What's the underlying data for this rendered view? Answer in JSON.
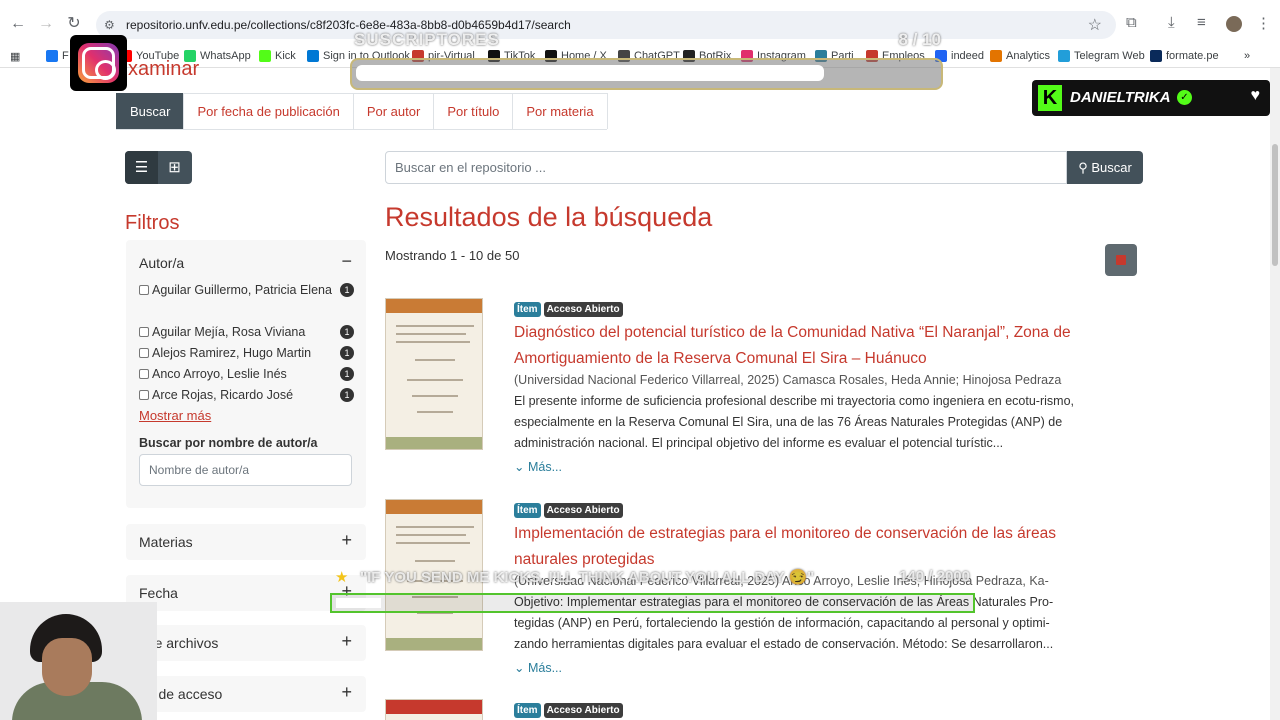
{
  "browser": {
    "url": "repositorio.unfv.edu.pe/collections/c8f203fc-6e8e-483a-8bb8-d0b4659b4d17/search",
    "bookmarks": [
      {
        "label": "F",
        "color": "#1877f2"
      },
      {
        "label": "YouTube",
        "color": "#ff0000"
      },
      {
        "label": "WhatsApp",
        "color": "#25d366"
      },
      {
        "label": "Kick",
        "color": "#53fc18"
      },
      {
        "label": "Sign in to Outlook",
        "color": "#0078d4"
      },
      {
        "label": "pir-Virtual",
        "color": "#c6392d"
      },
      {
        "label": "TikTok",
        "color": "#111111"
      },
      {
        "label": "Home / X",
        "color": "#111111"
      },
      {
        "label": "ChatGPT",
        "color": "#444444"
      },
      {
        "label": "BotRix",
        "color": "#222222"
      },
      {
        "label": "Instagram",
        "color": "#e1306c"
      },
      {
        "label": "Parti",
        "color": "#2b7e9b"
      },
      {
        "label": "Empleos",
        "color": "#c6392d"
      },
      {
        "label": "indeed",
        "color": "#2164f3"
      },
      {
        "label": "Analytics",
        "color": "#e37400"
      },
      {
        "label": "Telegram Web",
        "color": "#229ed9"
      },
      {
        "label": "formate.pe",
        "color": "#0a2a5a"
      }
    ]
  },
  "page": {
    "heading_fragment": "xaminar",
    "tabs": [
      "Buscar",
      "Por fecha de publicación",
      "Por autor",
      "Por título",
      "Por materia"
    ],
    "search": {
      "placeholder": "Buscar en el repositorio ...",
      "button": "Buscar"
    },
    "filters": {
      "title": "Filtros",
      "author_box": {
        "title": "Autor/a",
        "toggle": "−",
        "facets": [
          {
            "label": "Aguilar Guillermo, Patricia Elena",
            "count": "1"
          },
          {
            "label": "Aguilar Mejía, Rosa Viviana",
            "count": "1"
          },
          {
            "label": "Alejos Ramirez, Hugo Martin",
            "count": "1"
          },
          {
            "label": "Anco Arroyo, Leslie Inés",
            "count": "1"
          },
          {
            "label": "Arce Rojas, Ricardo José",
            "count": "1"
          }
        ],
        "show_more": "Mostrar más",
        "search_label": "Buscar por nombre de autor/a",
        "search_placeholder": "Nombre de autor/a"
      },
      "collapsed": [
        {
          "title": "Materias",
          "toggle": "+"
        },
        {
          "title": "Fecha",
          "toggle": "+"
        },
        {
          "title": "ene archivos",
          "toggle": "+"
        },
        {
          "title": "po de acceso",
          "toggle": "+"
        }
      ]
    },
    "results": {
      "title": "Resultados de la búsqueda",
      "showing": "Mostrando 1 - 10 de 50",
      "items": [
        {
          "badge_item": "Ítem",
          "badge_access": "Acceso Abierto",
          "title": "Diagnóstico del potencial turístico de la Comunidad Nativa “El Naranjal”, Zona de Amortiguamiento de la Reserva Comunal El Sira – Huánuco",
          "meta": "(Universidad Nacional Federico Villarreal, 2025) Camasca Rosales, Heda Annie; Hinojosa Pedraza",
          "abstract": "El presente informe de suficiencia profesional describe mi trayectoria como ingeniera en ecotu-rismo, especialmente en la Reserva Comunal El Sira, una de las 76 Áreas Naturales Protegidas (ANP) de administración nacional. El principal objetivo del informe es evaluar el potencial turístic...",
          "more": "Más..."
        },
        {
          "badge_item": "Ítem",
          "badge_access": "Acceso Abierto",
          "title": "Implementación de estrategias para el monitoreo de conservación de las áreas naturales protegidas",
          "meta": "(Universidad Nacional Federico Villarreal, 2025) Anco Arroyo, Leslie Inés; Hinojosa Pedraza, Ka-",
          "abstract": "Objetivo: Implementar estrategias para el monitoreo de conservación de las Áreas Naturales Pro-tegidas (ANP) en Perú, fortaleciendo la gestión de información, capacitando al personal y optimi-zando herramientas digitales para evaluar el estado de conservación. Método: Se desarrollaron...",
          "more": "Más..."
        },
        {
          "badge_item": "Ítem",
          "badge_access": "Acceso Abierto"
        }
      ]
    }
  },
  "overlay": {
    "sub_goal": {
      "label": "SUSCRIPTORES",
      "count": "8 / 10",
      "progress": 0.8
    },
    "streamer": {
      "name": "DANIELTRIKA",
      "logo": "K"
    },
    "kicks_goal": {
      "label": "\"IF YOU SEND ME KICKS, I'LL THINK ABOUT YOU ALL DAY 😏\"",
      "count": "140 / 2000",
      "progress": 0.07
    }
  }
}
